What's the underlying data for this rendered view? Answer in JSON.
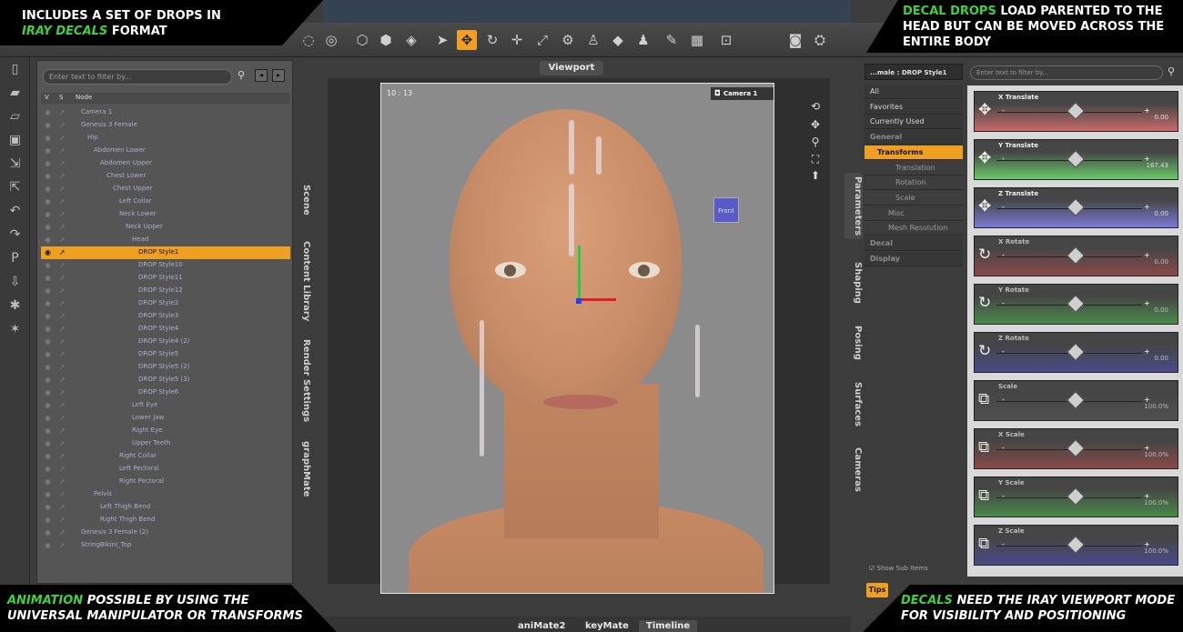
{
  "banners": {
    "top_left": {
      "line1": "INCLUDES A SET OF DROPS IN",
      "line2_highlight": "IRAY DECALS",
      "line2_rest": "FORMAT"
    },
    "top_right": {
      "highlight": "DECAL DROPS",
      "rest1": " LOAD PARENTED TO THE",
      "line2": "HEAD BUT CAN BE MOVED ACROSS THE",
      "line3": "ENTIRE BODY"
    },
    "bottom_left": {
      "highlight": "ANIMATION",
      "rest1": "POSSIBLE BY USING THE",
      "line2": "UNIVERSAL MANIPULATOR OR TRANSFORMS"
    },
    "bottom_right": {
      "highlight": "DECALS",
      "rest1": "NEED THE IRAY VIEWPORT MODE",
      "line2": "FOR VISIBILITY AND POSITIONING"
    }
  },
  "scene": {
    "filter_placeholder": "Enter text to filter by...",
    "columns": {
      "v": "V",
      "s": "S",
      "node": "Node"
    },
    "nodes": [
      {
        "label": "Camera 1",
        "indent": 0
      },
      {
        "label": "Genesis 3 Female",
        "indent": 0
      },
      {
        "label": "Hip",
        "indent": 1
      },
      {
        "label": "Abdomen Lower",
        "indent": 2
      },
      {
        "label": "Abdomen Upper",
        "indent": 3
      },
      {
        "label": "Chest Lower",
        "indent": 4
      },
      {
        "label": "Chest Upper",
        "indent": 5
      },
      {
        "label": "Left Collar",
        "indent": 6
      },
      {
        "label": "Neck Lower",
        "indent": 6
      },
      {
        "label": "Neck Upper",
        "indent": 7
      },
      {
        "label": "Head",
        "indent": 8
      },
      {
        "label": "DROP Style1",
        "indent": 9,
        "selected": true
      },
      {
        "label": "DROP Style10",
        "indent": 9
      },
      {
        "label": "DROP Style11",
        "indent": 9
      },
      {
        "label": "DROP Style12",
        "indent": 9
      },
      {
        "label": "DROP Style2",
        "indent": 9
      },
      {
        "label": "DROP Style3",
        "indent": 9
      },
      {
        "label": "DROP Style4",
        "indent": 9
      },
      {
        "label": "DROP Style4 (2)",
        "indent": 9
      },
      {
        "label": "DROP Style5",
        "indent": 9
      },
      {
        "label": "DROP Style5 (2)",
        "indent": 9
      },
      {
        "label": "DROP Style5 (3)",
        "indent": 9
      },
      {
        "label": "DROP Style6",
        "indent": 9
      },
      {
        "label": "Left Eye",
        "indent": 8
      },
      {
        "label": "Lower Jaw",
        "indent": 8
      },
      {
        "label": "Right Eye",
        "indent": 8
      },
      {
        "label": "Upper Teeth",
        "indent": 8
      },
      {
        "label": "Right Collar",
        "indent": 6
      },
      {
        "label": "Left Pectoral",
        "indent": 6
      },
      {
        "label": "Right Pectoral",
        "indent": 6
      },
      {
        "label": "Pelvis",
        "indent": 2
      },
      {
        "label": "Left Thigh Bend",
        "indent": 3
      },
      {
        "label": "Right Thigh Bend",
        "indent": 3
      },
      {
        "label": "Genesis 3 Female (2)",
        "indent": 0
      },
      {
        "label": "StringBikini_Top",
        "indent": 0
      }
    ]
  },
  "left_tabs": [
    "Scene",
    "Content Library",
    "Render Settings",
    "graphMate"
  ],
  "viewport": {
    "title": "Viewport",
    "time": "10 : 13",
    "camera": "Camera 1",
    "cube_label": "Front"
  },
  "right_tabs": [
    "Parameters",
    "Shaping",
    "Posing",
    "Surfaces",
    "Cameras"
  ],
  "param_nav": {
    "node_select": "...male : DROP Style1",
    "items": [
      {
        "label": "All",
        "type": "top"
      },
      {
        "label": "Favorites",
        "type": "top"
      },
      {
        "label": "Currently Used",
        "type": "top"
      },
      {
        "label": "General",
        "type": "head"
      },
      {
        "label": "Transforms",
        "type": "active"
      },
      {
        "label": "Translation",
        "type": "sub"
      },
      {
        "label": "Rotation",
        "type": "sub"
      },
      {
        "label": "Scale",
        "type": "sub"
      },
      {
        "label": "Misc",
        "type": "sub2"
      },
      {
        "label": "Mesh Resolution",
        "type": "sub2"
      },
      {
        "label": "Decal",
        "type": "head"
      },
      {
        "label": "Display",
        "type": "head"
      }
    ],
    "show_sub_items": "Show Sub Items"
  },
  "param_filter_placeholder": "Enter text to filter by...",
  "parameters": [
    {
      "name": "X Translate",
      "value": "0.00",
      "color": "#c86a6a"
    },
    {
      "name": "Y Translate",
      "value": "167.43",
      "color": "#6ac86a"
    },
    {
      "name": "Z Translate",
      "value": "0.00",
      "color": "#7a7ad8"
    },
    {
      "name": "X Rotate",
      "value": "0.00",
      "color": "#8a4a4a"
    },
    {
      "name": "Y Rotate",
      "value": "0.00",
      "color": "#4a8a4a"
    },
    {
      "name": "Z Rotate",
      "value": "0.00",
      "color": "#4a4a8a"
    },
    {
      "name": "Scale",
      "value": "100.0%",
      "color": "#505050"
    },
    {
      "name": "X Scale",
      "value": "100.0%",
      "color": "#8a4a4a"
    },
    {
      "name": "Y Scale",
      "value": "100.0%",
      "color": "#4a8a4a"
    },
    {
      "name": "Z Scale",
      "value": "100.0%",
      "color": "#4a4a8a"
    }
  ],
  "bottom_tabs": [
    "aniMate2",
    "keyMate",
    "Timeline"
  ],
  "tips_label": "Tips",
  "colors": {
    "accent": "#f0a020",
    "highlight_green": "#3cd33c"
  }
}
